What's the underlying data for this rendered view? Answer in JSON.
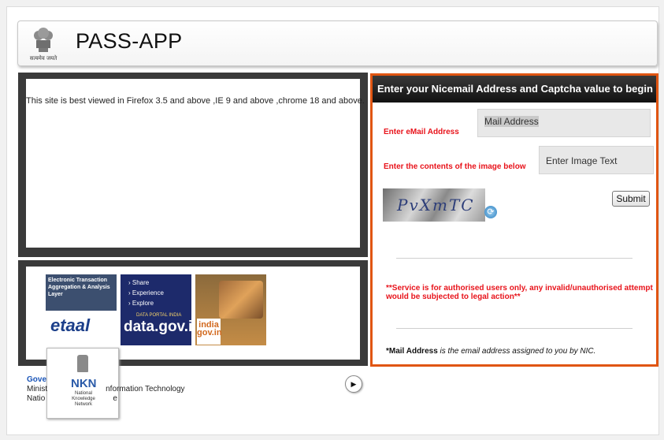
{
  "header": {
    "app_title": "PASS-APP",
    "emblem_motto": "सत्यमेव जयते"
  },
  "left": {
    "browser_notice": "This site is best viewed in Firefox 3.5 and above ,IE 9 and above ,chrome 18 and above."
  },
  "banners": {
    "etaal": {
      "heading": "Electronic Transaction Aggregation & Analysis Layer",
      "logo": "etaal"
    },
    "datagov": {
      "menu": [
        "› Share",
        "› Experience",
        "› Explore"
      ],
      "portal": "DATA PORTAL INDIA",
      "logo": "data.gov.in"
    },
    "indiagov": {
      "logo": "india gov.in"
    },
    "nkn_popup": {
      "logo": "NKN",
      "text": "National Knowledge Network"
    }
  },
  "footer": {
    "line1": "Gove",
    "line2a": "Minist",
    "line2b": "nformation Technology",
    "line3a": "Natio",
    "line3b": "e",
    "next_icon": "▶"
  },
  "login": {
    "panel_title": "Enter your Nicemail Address and Captcha value to begin",
    "email_label": "Enter eMail Address",
    "email_placeholder": "Mail Address",
    "image_label": "Enter the contents of the image below",
    "image_placeholder": "Enter Image Text",
    "captcha_text": "PvⅩmTC",
    "submit_label": "Submit",
    "warning": "**Service is for authorised users only, any invalid/unauthorised attempt would be subjected to legal action**",
    "note_bold": "*Mail Address",
    "note_italic": " is the email address assigned to you by NIC."
  },
  "colors": {
    "accent_border": "#e05512",
    "label_red": "#e8131b",
    "panel_header": "#111111"
  }
}
